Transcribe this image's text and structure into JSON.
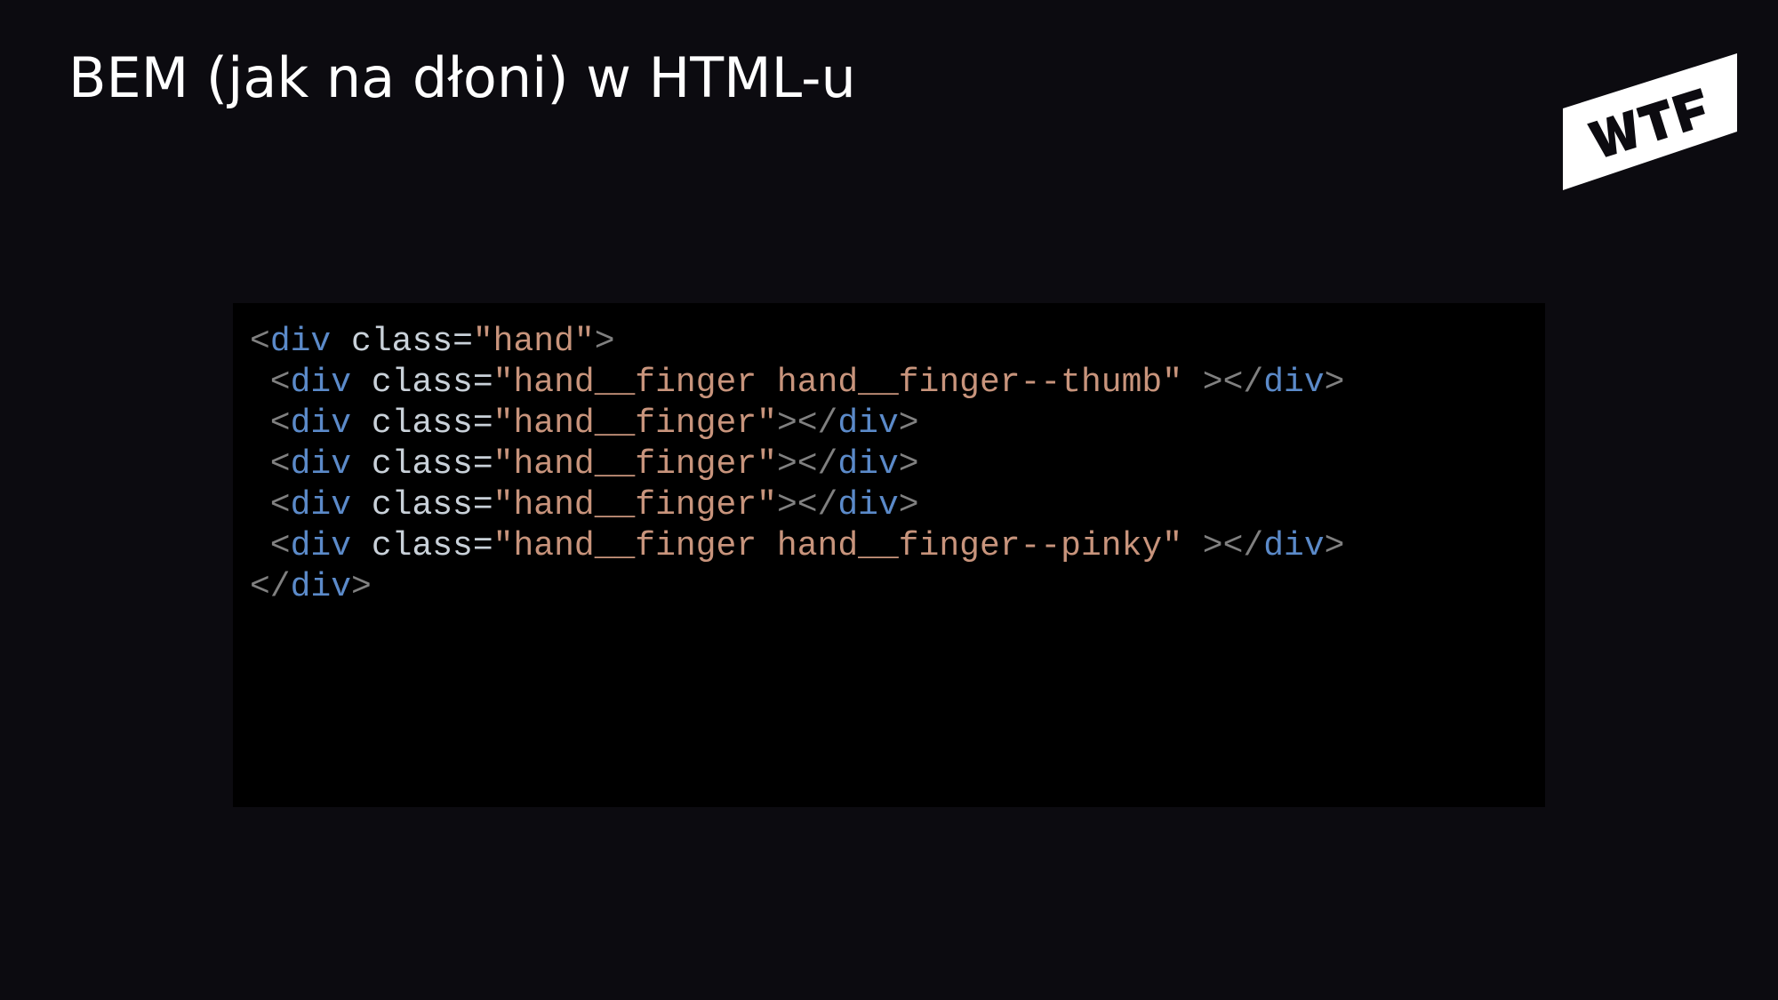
{
  "slide": {
    "title": "BEM (jak na dłoni) w HTML-u",
    "logo": {
      "icon": "wtf-logo",
      "text": "WTF"
    }
  },
  "code": {
    "language": "html",
    "lines": [
      [
        {
          "type": "punct",
          "text": "<"
        },
        {
          "type": "tag",
          "text": "div"
        },
        {
          "type": "punct",
          "text": " "
        },
        {
          "type": "attr",
          "text": "class="
        },
        {
          "type": "value",
          "text": "\"hand\""
        },
        {
          "type": "punct",
          "text": ">"
        }
      ],
      [
        {
          "type": "punct",
          "text": " <"
        },
        {
          "type": "tag",
          "text": "div"
        },
        {
          "type": "punct",
          "text": " "
        },
        {
          "type": "attr",
          "text": "class="
        },
        {
          "type": "value",
          "text": "\"hand__finger hand__finger--thumb\""
        },
        {
          "type": "punct",
          "text": " ></"
        },
        {
          "type": "tag",
          "text": "div"
        },
        {
          "type": "punct",
          "text": ">"
        }
      ],
      [
        {
          "type": "punct",
          "text": " <"
        },
        {
          "type": "tag",
          "text": "div"
        },
        {
          "type": "punct",
          "text": " "
        },
        {
          "type": "attr",
          "text": "class="
        },
        {
          "type": "value",
          "text": "\"hand__finger\""
        },
        {
          "type": "punct",
          "text": "></"
        },
        {
          "type": "tag",
          "text": "div"
        },
        {
          "type": "punct",
          "text": ">"
        }
      ],
      [
        {
          "type": "punct",
          "text": " <"
        },
        {
          "type": "tag",
          "text": "div"
        },
        {
          "type": "punct",
          "text": " "
        },
        {
          "type": "attr",
          "text": "class="
        },
        {
          "type": "value",
          "text": "\"hand__finger\""
        },
        {
          "type": "punct",
          "text": "></"
        },
        {
          "type": "tag",
          "text": "div"
        },
        {
          "type": "punct",
          "text": ">"
        }
      ],
      [
        {
          "type": "punct",
          "text": " <"
        },
        {
          "type": "tag",
          "text": "div"
        },
        {
          "type": "punct",
          "text": " "
        },
        {
          "type": "attr",
          "text": "class="
        },
        {
          "type": "value",
          "text": "\"hand__finger\""
        },
        {
          "type": "punct",
          "text": "></"
        },
        {
          "type": "tag",
          "text": "div"
        },
        {
          "type": "punct",
          "text": ">"
        }
      ],
      [
        {
          "type": "punct",
          "text": " <"
        },
        {
          "type": "tag",
          "text": "div"
        },
        {
          "type": "punct",
          "text": " "
        },
        {
          "type": "attr",
          "text": "class="
        },
        {
          "type": "value",
          "text": "\"hand__finger hand__finger--pinky\""
        },
        {
          "type": "punct",
          "text": " ></"
        },
        {
          "type": "tag",
          "text": "div"
        },
        {
          "type": "punct",
          "text": ">"
        }
      ],
      [
        {
          "type": "punct",
          "text": "</"
        },
        {
          "type": "tag",
          "text": "div"
        },
        {
          "type": "punct",
          "text": ">"
        }
      ]
    ]
  },
  "colors": {
    "background": "#0c0b10",
    "code_background": "#000000",
    "title": "#ffffff",
    "punct": "#808080",
    "tag": "#5b8ac9",
    "attr": "#c9d1d9",
    "value": "#c8947c"
  }
}
